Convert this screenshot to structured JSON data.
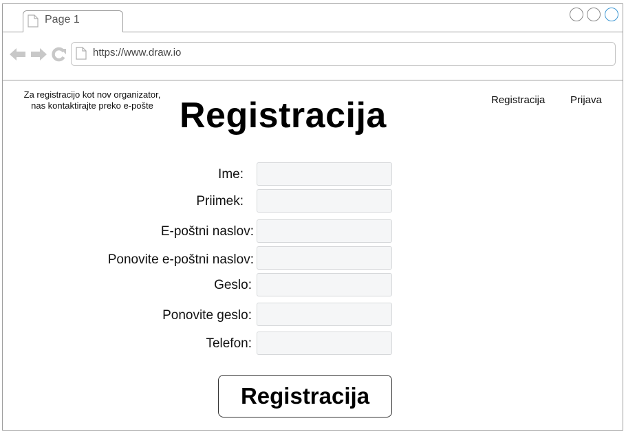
{
  "browser": {
    "tab_title": "Page 1",
    "url": "https://www.draw.io",
    "icons": {
      "back": "arrow-left-icon",
      "forward": "arrow-right-icon",
      "reload": "reload-icon",
      "page": "page-icon"
    }
  },
  "header": {
    "info_line1": "Za registracijo kot nov organizator,",
    "info_line2": "nas kontaktirajte preko e-pošte",
    "title": "Registracija",
    "nav": [
      {
        "label": "Registracija"
      },
      {
        "label": "Prijava"
      }
    ]
  },
  "form": {
    "fields": [
      {
        "label": "Ime:",
        "value": ""
      },
      {
        "label": "Priimek:",
        "value": ""
      },
      {
        "label": "E-poštni naslov:",
        "value": ""
      },
      {
        "label": "Ponovite e-poštni naslov:",
        "value": ""
      },
      {
        "label": "Geslo:",
        "value": ""
      },
      {
        "label": "Ponovite geslo:",
        "value": ""
      },
      {
        "label": "Telefon:",
        "value": ""
      }
    ],
    "submit_label": "Registracija"
  },
  "colors": {
    "border": "#9e9e9e",
    "field_bg": "#f5f6f7",
    "icon_gray": "#c8c8c8",
    "window_accent": "#3c96d2"
  }
}
